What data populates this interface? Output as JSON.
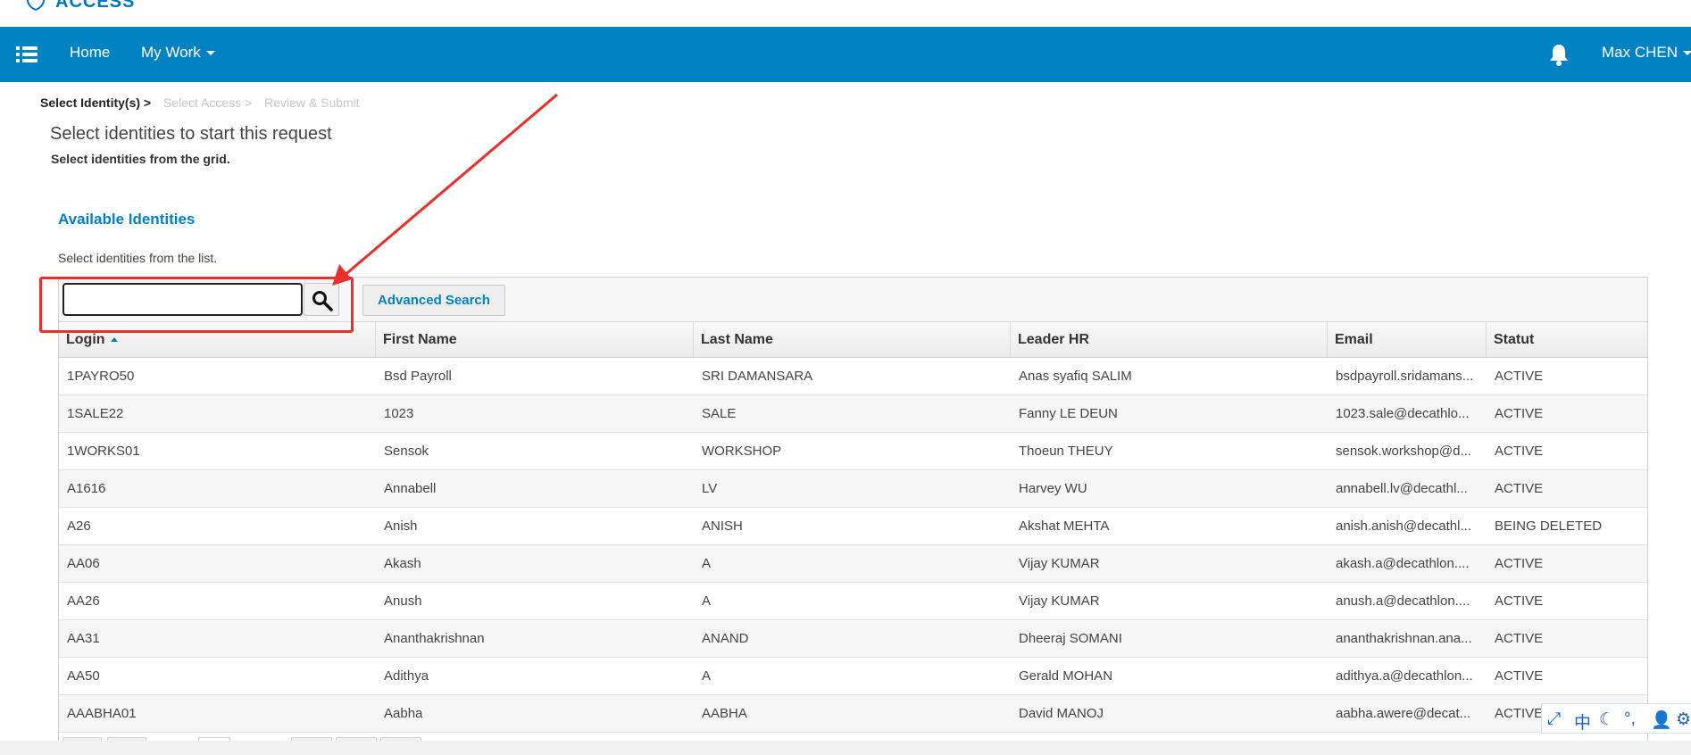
{
  "logo": {
    "text": "ACCESS"
  },
  "navbar": {
    "home": "Home",
    "my_work": "My Work",
    "user": "Max CHEN"
  },
  "breadcrumb": {
    "step1": "Select Identity(s) >",
    "step2": "Select Access >",
    "step3": "Review & Submit"
  },
  "page": {
    "title": "Select identities to start this request",
    "subtitle": "Select identities from the grid."
  },
  "section": {
    "title": "Available Identities",
    "description": "Select identities from the list."
  },
  "toolbar": {
    "search_value": "",
    "advanced_search": "Advanced Search"
  },
  "table": {
    "columns": [
      "Login",
      "First Name",
      "Last Name",
      "Leader HR",
      "Email",
      "Statut"
    ],
    "sorted_column": "Login",
    "sort_direction": "ascending",
    "rows": [
      [
        "1PAYRO50",
        "Bsd Payroll",
        "SRI DAMANSARA",
        "Anas syafiq SALIM",
        "bsdpayroll.sridamans...",
        "ACTIVE"
      ],
      [
        "1SALE22",
        "1023",
        "SALE",
        "Fanny LE DEUN",
        "1023.sale@decathlo...",
        "ACTIVE"
      ],
      [
        "1WORKS01",
        "Sensok",
        "WORKSHOP",
        "Thoeun THEUY",
        "sensok.workshop@d...",
        "ACTIVE"
      ],
      [
        "A1616",
        "Annabell",
        "LV",
        "Harvey WU",
        "annabell.lv@decathl...",
        "ACTIVE"
      ],
      [
        "A26",
        "Anish",
        "ANISH",
        "Akshat MEHTA",
        "anish.anish@decathl...",
        "BEING DELETED"
      ],
      [
        "AA06",
        "Akash",
        "A",
        "Vijay KUMAR",
        "akash.a@decathlon....",
        "ACTIVE"
      ],
      [
        "AA26",
        "Anush",
        "A",
        "Vijay KUMAR",
        "anush.a@decathlon....",
        "ACTIVE"
      ],
      [
        "AA31",
        "Ananthakrishnan",
        "ANAND",
        "Dheeraj SOMANI",
        "ananthakrishnan.ana...",
        "ACTIVE"
      ],
      [
        "AA50",
        "Adithya",
        "A",
        "Gerald MOHAN",
        "adithya.a@decathlon...",
        "ACTIVE"
      ],
      [
        "AAABHA01",
        "Aabha",
        "AABHA",
        "David MANOJ",
        "aabha.awere@decat...",
        "ACTIVE"
      ]
    ]
  },
  "ime": {
    "mode": "中"
  },
  "colors": {
    "brand": "#0082c3",
    "annotation": "#e8302c"
  }
}
